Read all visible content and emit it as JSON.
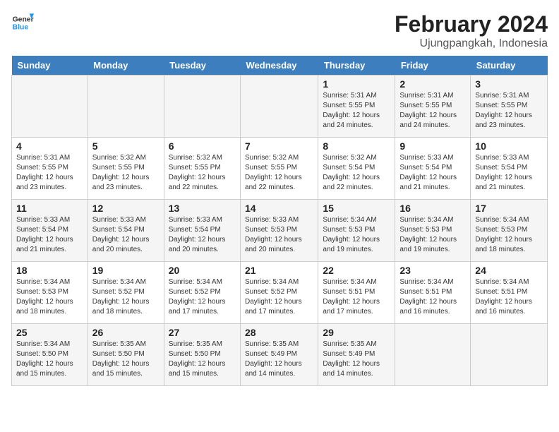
{
  "logo": {
    "text_general": "General",
    "text_blue": "Blue"
  },
  "header": {
    "title": "February 2024",
    "subtitle": "Ujungpangkah, Indonesia"
  },
  "weekdays": [
    "Sunday",
    "Monday",
    "Tuesday",
    "Wednesday",
    "Thursday",
    "Friday",
    "Saturday"
  ],
  "weeks": [
    {
      "days": [
        {
          "num": "",
          "info": ""
        },
        {
          "num": "",
          "info": ""
        },
        {
          "num": "",
          "info": ""
        },
        {
          "num": "",
          "info": ""
        },
        {
          "num": "1",
          "info": "Sunrise: 5:31 AM\nSunset: 5:55 PM\nDaylight: 12 hours\nand 24 minutes."
        },
        {
          "num": "2",
          "info": "Sunrise: 5:31 AM\nSunset: 5:55 PM\nDaylight: 12 hours\nand 24 minutes."
        },
        {
          "num": "3",
          "info": "Sunrise: 5:31 AM\nSunset: 5:55 PM\nDaylight: 12 hours\nand 23 minutes."
        }
      ]
    },
    {
      "days": [
        {
          "num": "4",
          "info": "Sunrise: 5:31 AM\nSunset: 5:55 PM\nDaylight: 12 hours\nand 23 minutes."
        },
        {
          "num": "5",
          "info": "Sunrise: 5:32 AM\nSunset: 5:55 PM\nDaylight: 12 hours\nand 23 minutes."
        },
        {
          "num": "6",
          "info": "Sunrise: 5:32 AM\nSunset: 5:55 PM\nDaylight: 12 hours\nand 22 minutes."
        },
        {
          "num": "7",
          "info": "Sunrise: 5:32 AM\nSunset: 5:55 PM\nDaylight: 12 hours\nand 22 minutes."
        },
        {
          "num": "8",
          "info": "Sunrise: 5:32 AM\nSunset: 5:54 PM\nDaylight: 12 hours\nand 22 minutes."
        },
        {
          "num": "9",
          "info": "Sunrise: 5:33 AM\nSunset: 5:54 PM\nDaylight: 12 hours\nand 21 minutes."
        },
        {
          "num": "10",
          "info": "Sunrise: 5:33 AM\nSunset: 5:54 PM\nDaylight: 12 hours\nand 21 minutes."
        }
      ]
    },
    {
      "days": [
        {
          "num": "11",
          "info": "Sunrise: 5:33 AM\nSunset: 5:54 PM\nDaylight: 12 hours\nand 21 minutes."
        },
        {
          "num": "12",
          "info": "Sunrise: 5:33 AM\nSunset: 5:54 PM\nDaylight: 12 hours\nand 20 minutes."
        },
        {
          "num": "13",
          "info": "Sunrise: 5:33 AM\nSunset: 5:54 PM\nDaylight: 12 hours\nand 20 minutes."
        },
        {
          "num": "14",
          "info": "Sunrise: 5:33 AM\nSunset: 5:53 PM\nDaylight: 12 hours\nand 20 minutes."
        },
        {
          "num": "15",
          "info": "Sunrise: 5:34 AM\nSunset: 5:53 PM\nDaylight: 12 hours\nand 19 minutes."
        },
        {
          "num": "16",
          "info": "Sunrise: 5:34 AM\nSunset: 5:53 PM\nDaylight: 12 hours\nand 19 minutes."
        },
        {
          "num": "17",
          "info": "Sunrise: 5:34 AM\nSunset: 5:53 PM\nDaylight: 12 hours\nand 18 minutes."
        }
      ]
    },
    {
      "days": [
        {
          "num": "18",
          "info": "Sunrise: 5:34 AM\nSunset: 5:53 PM\nDaylight: 12 hours\nand 18 minutes."
        },
        {
          "num": "19",
          "info": "Sunrise: 5:34 AM\nSunset: 5:52 PM\nDaylight: 12 hours\nand 18 minutes."
        },
        {
          "num": "20",
          "info": "Sunrise: 5:34 AM\nSunset: 5:52 PM\nDaylight: 12 hours\nand 17 minutes."
        },
        {
          "num": "21",
          "info": "Sunrise: 5:34 AM\nSunset: 5:52 PM\nDaylight: 12 hours\nand 17 minutes."
        },
        {
          "num": "22",
          "info": "Sunrise: 5:34 AM\nSunset: 5:51 PM\nDaylight: 12 hours\nand 17 minutes."
        },
        {
          "num": "23",
          "info": "Sunrise: 5:34 AM\nSunset: 5:51 PM\nDaylight: 12 hours\nand 16 minutes."
        },
        {
          "num": "24",
          "info": "Sunrise: 5:34 AM\nSunset: 5:51 PM\nDaylight: 12 hours\nand 16 minutes."
        }
      ]
    },
    {
      "days": [
        {
          "num": "25",
          "info": "Sunrise: 5:34 AM\nSunset: 5:50 PM\nDaylight: 12 hours\nand 15 minutes."
        },
        {
          "num": "26",
          "info": "Sunrise: 5:35 AM\nSunset: 5:50 PM\nDaylight: 12 hours\nand 15 minutes."
        },
        {
          "num": "27",
          "info": "Sunrise: 5:35 AM\nSunset: 5:50 PM\nDaylight: 12 hours\nand 15 minutes."
        },
        {
          "num": "28",
          "info": "Sunrise: 5:35 AM\nSunset: 5:49 PM\nDaylight: 12 hours\nand 14 minutes."
        },
        {
          "num": "29",
          "info": "Sunrise: 5:35 AM\nSunset: 5:49 PM\nDaylight: 12 hours\nand 14 minutes."
        },
        {
          "num": "",
          "info": ""
        },
        {
          "num": "",
          "info": ""
        }
      ]
    }
  ]
}
